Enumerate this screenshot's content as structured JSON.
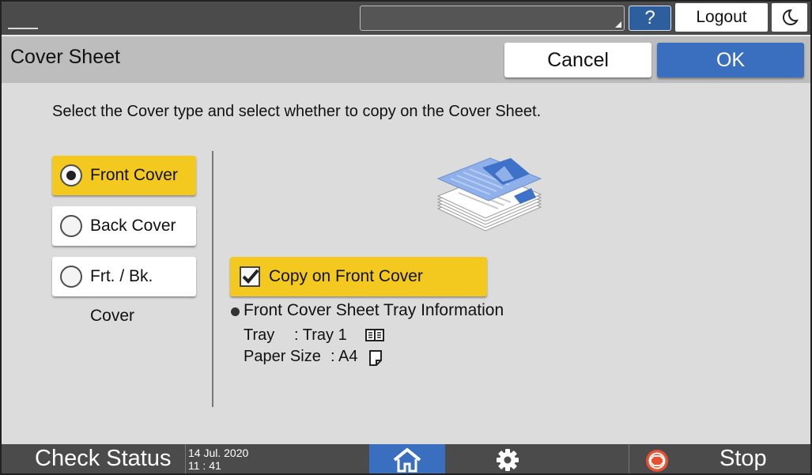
{
  "header": {
    "help_label": "?",
    "logout_label": "Logout"
  },
  "titlebar": {
    "title": "Cover Sheet",
    "cancel_label": "Cancel",
    "ok_label": "OK"
  },
  "main": {
    "instruction": "Select the Cover type and select whether to copy on the Cover Sheet.",
    "cover_options": [
      {
        "label": "Front Cover",
        "selected": true
      },
      {
        "label": "Back Cover",
        "selected": false
      },
      {
        "label": "Frt. / Bk. Cover",
        "selected": false
      }
    ],
    "copy_on_cover": {
      "label": "Copy on Front Cover",
      "checked": true
    },
    "tray_info": {
      "heading": "Front Cover Sheet Tray Information",
      "tray_label": "Tray",
      "tray_value": ": Tray 1",
      "tray_icon": "paper-tray-icon",
      "size_label": "Paper Size",
      "size_value": ": A4",
      "size_icon": "paper-sheet-icon"
    }
  },
  "footer": {
    "check_status_label": "Check Status",
    "date": "14 Jul. 2020",
    "time": "11 : 41",
    "home_icon": "home-icon",
    "settings_icon": "gear-icon",
    "stop_icon": "stop-icon",
    "stop_label": "Stop"
  },
  "colors": {
    "accent_blue": "#3a6fc0",
    "selected_yellow": "#f3c91f",
    "bar_dark": "#4b4b4b",
    "title_gray": "#bdbdbd",
    "content_gray": "#dcdcdc"
  }
}
